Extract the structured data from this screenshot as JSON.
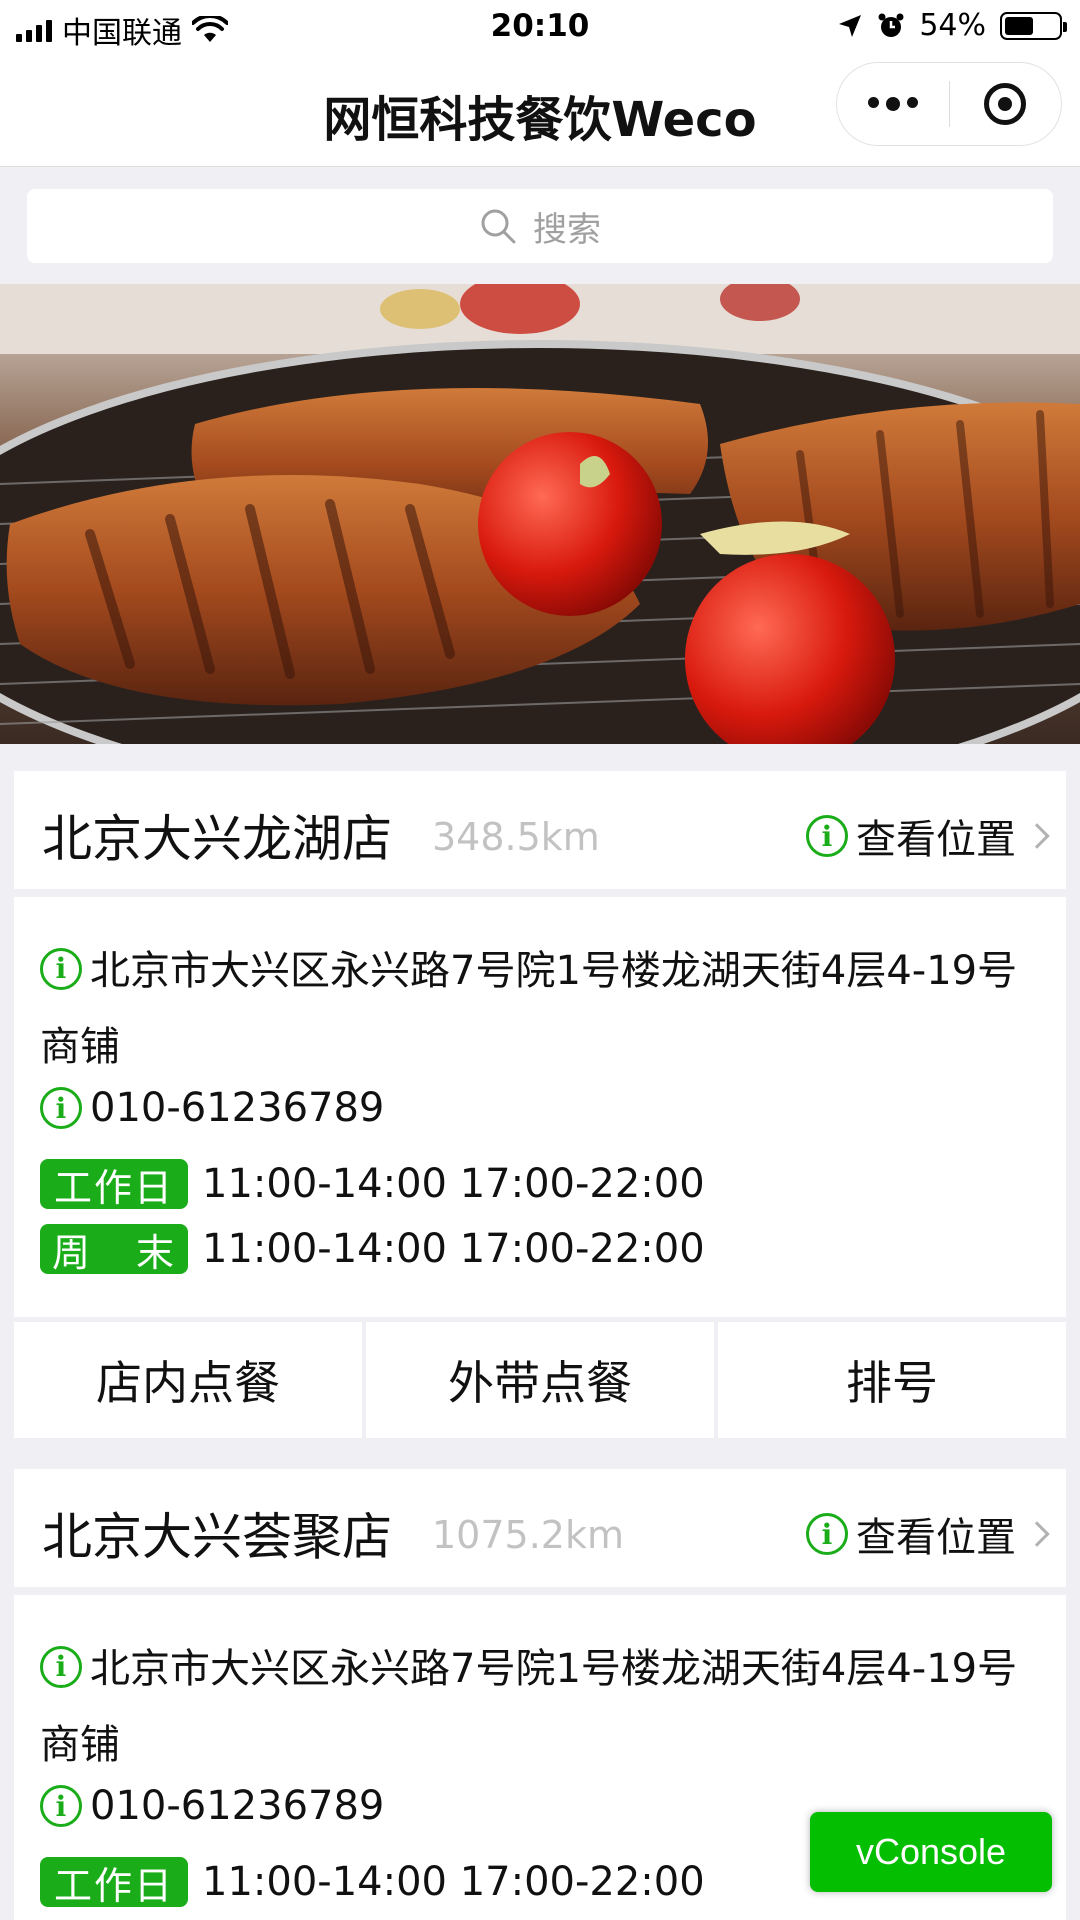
{
  "status_bar": {
    "carrier": "中国联通",
    "time": "20:10",
    "battery": "54%",
    "battery_level": 0.54
  },
  "navbar": {
    "title": "网恒科技餐饮Weco",
    "menu_icon": "more-dots-icon",
    "close_icon": "target-circle-icon"
  },
  "search": {
    "placeholder": "搜索",
    "icon": "search-icon"
  },
  "banner": {
    "icon": "food-photo"
  },
  "stores": [
    {
      "name": "北京大兴龙湖店",
      "distance": "348.5km",
      "locate_label": "查看位置",
      "address": "北京市大兴区永兴路7号院1号楼龙湖天街4层4-19号商铺",
      "phone": "010-61236789",
      "weekday_tag": "工作日",
      "weekday_hours": "11:00-14:00 17:00-22:00",
      "weekend_tag_1": "周",
      "weekend_tag_2": "末",
      "weekend_hours": "11:00-14:00 17:00-22:00",
      "actions": [
        "店内点餐",
        "外带点餐",
        "排号"
      ]
    },
    {
      "name": "北京大兴荟聚店",
      "distance": "1075.2km",
      "locate_label": "查看位置",
      "address": "北京市大兴区永兴路7号院1号楼龙湖天街4层4-19号商铺",
      "phone": "010-61236789",
      "weekday_tag": "工作日",
      "weekday_hours": "11:00-14:00 17:00-22:00"
    }
  ],
  "vconsole_label": "vConsole",
  "colors": {
    "accent_green": "#1aad19",
    "vconsole_green": "#04be02",
    "page_bg": "#efeff4"
  }
}
